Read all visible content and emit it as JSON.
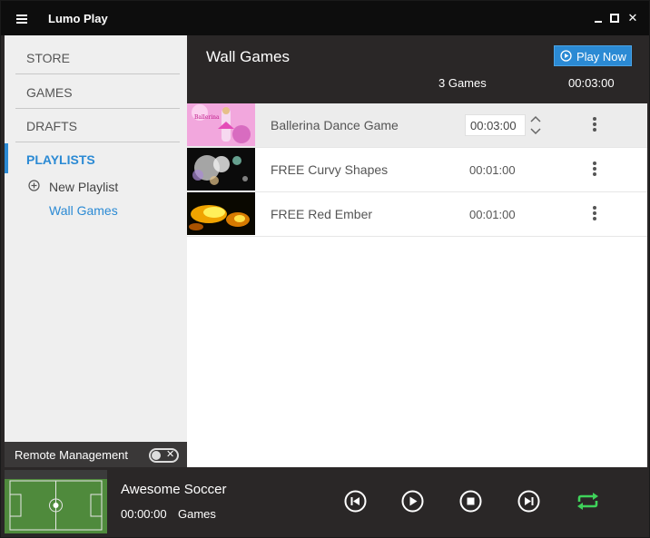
{
  "app": {
    "title": "Lumo Play"
  },
  "sidebar": {
    "nav": [
      {
        "label": "STORE"
      },
      {
        "label": "GAMES"
      },
      {
        "label": "DRAFTS"
      },
      {
        "label": "PLAYLISTS"
      }
    ],
    "playlists": {
      "new_label": "New Playlist",
      "items": [
        {
          "label": "Wall Games"
        }
      ]
    },
    "remote": {
      "label": "Remote Management",
      "enabled": false
    }
  },
  "main": {
    "title": "Wall Games",
    "play_now_label": "Play Now",
    "count_label": "3 Games",
    "total_duration": "00:03:00",
    "games": [
      {
        "name": "Ballerina Dance Game",
        "duration": "00:03:00",
        "selected": true
      },
      {
        "name": "FREE Curvy Shapes",
        "duration": "00:01:00",
        "selected": false
      },
      {
        "name": "FREE Red Ember",
        "duration": "00:01:00",
        "selected": false
      }
    ]
  },
  "player": {
    "title": "Awesome Soccer",
    "time": "00:00:00",
    "category": "Games",
    "repeat_color": "#3fd25a"
  },
  "colors": {
    "accent": "#2b8ad4",
    "dark": "#2a2727"
  }
}
